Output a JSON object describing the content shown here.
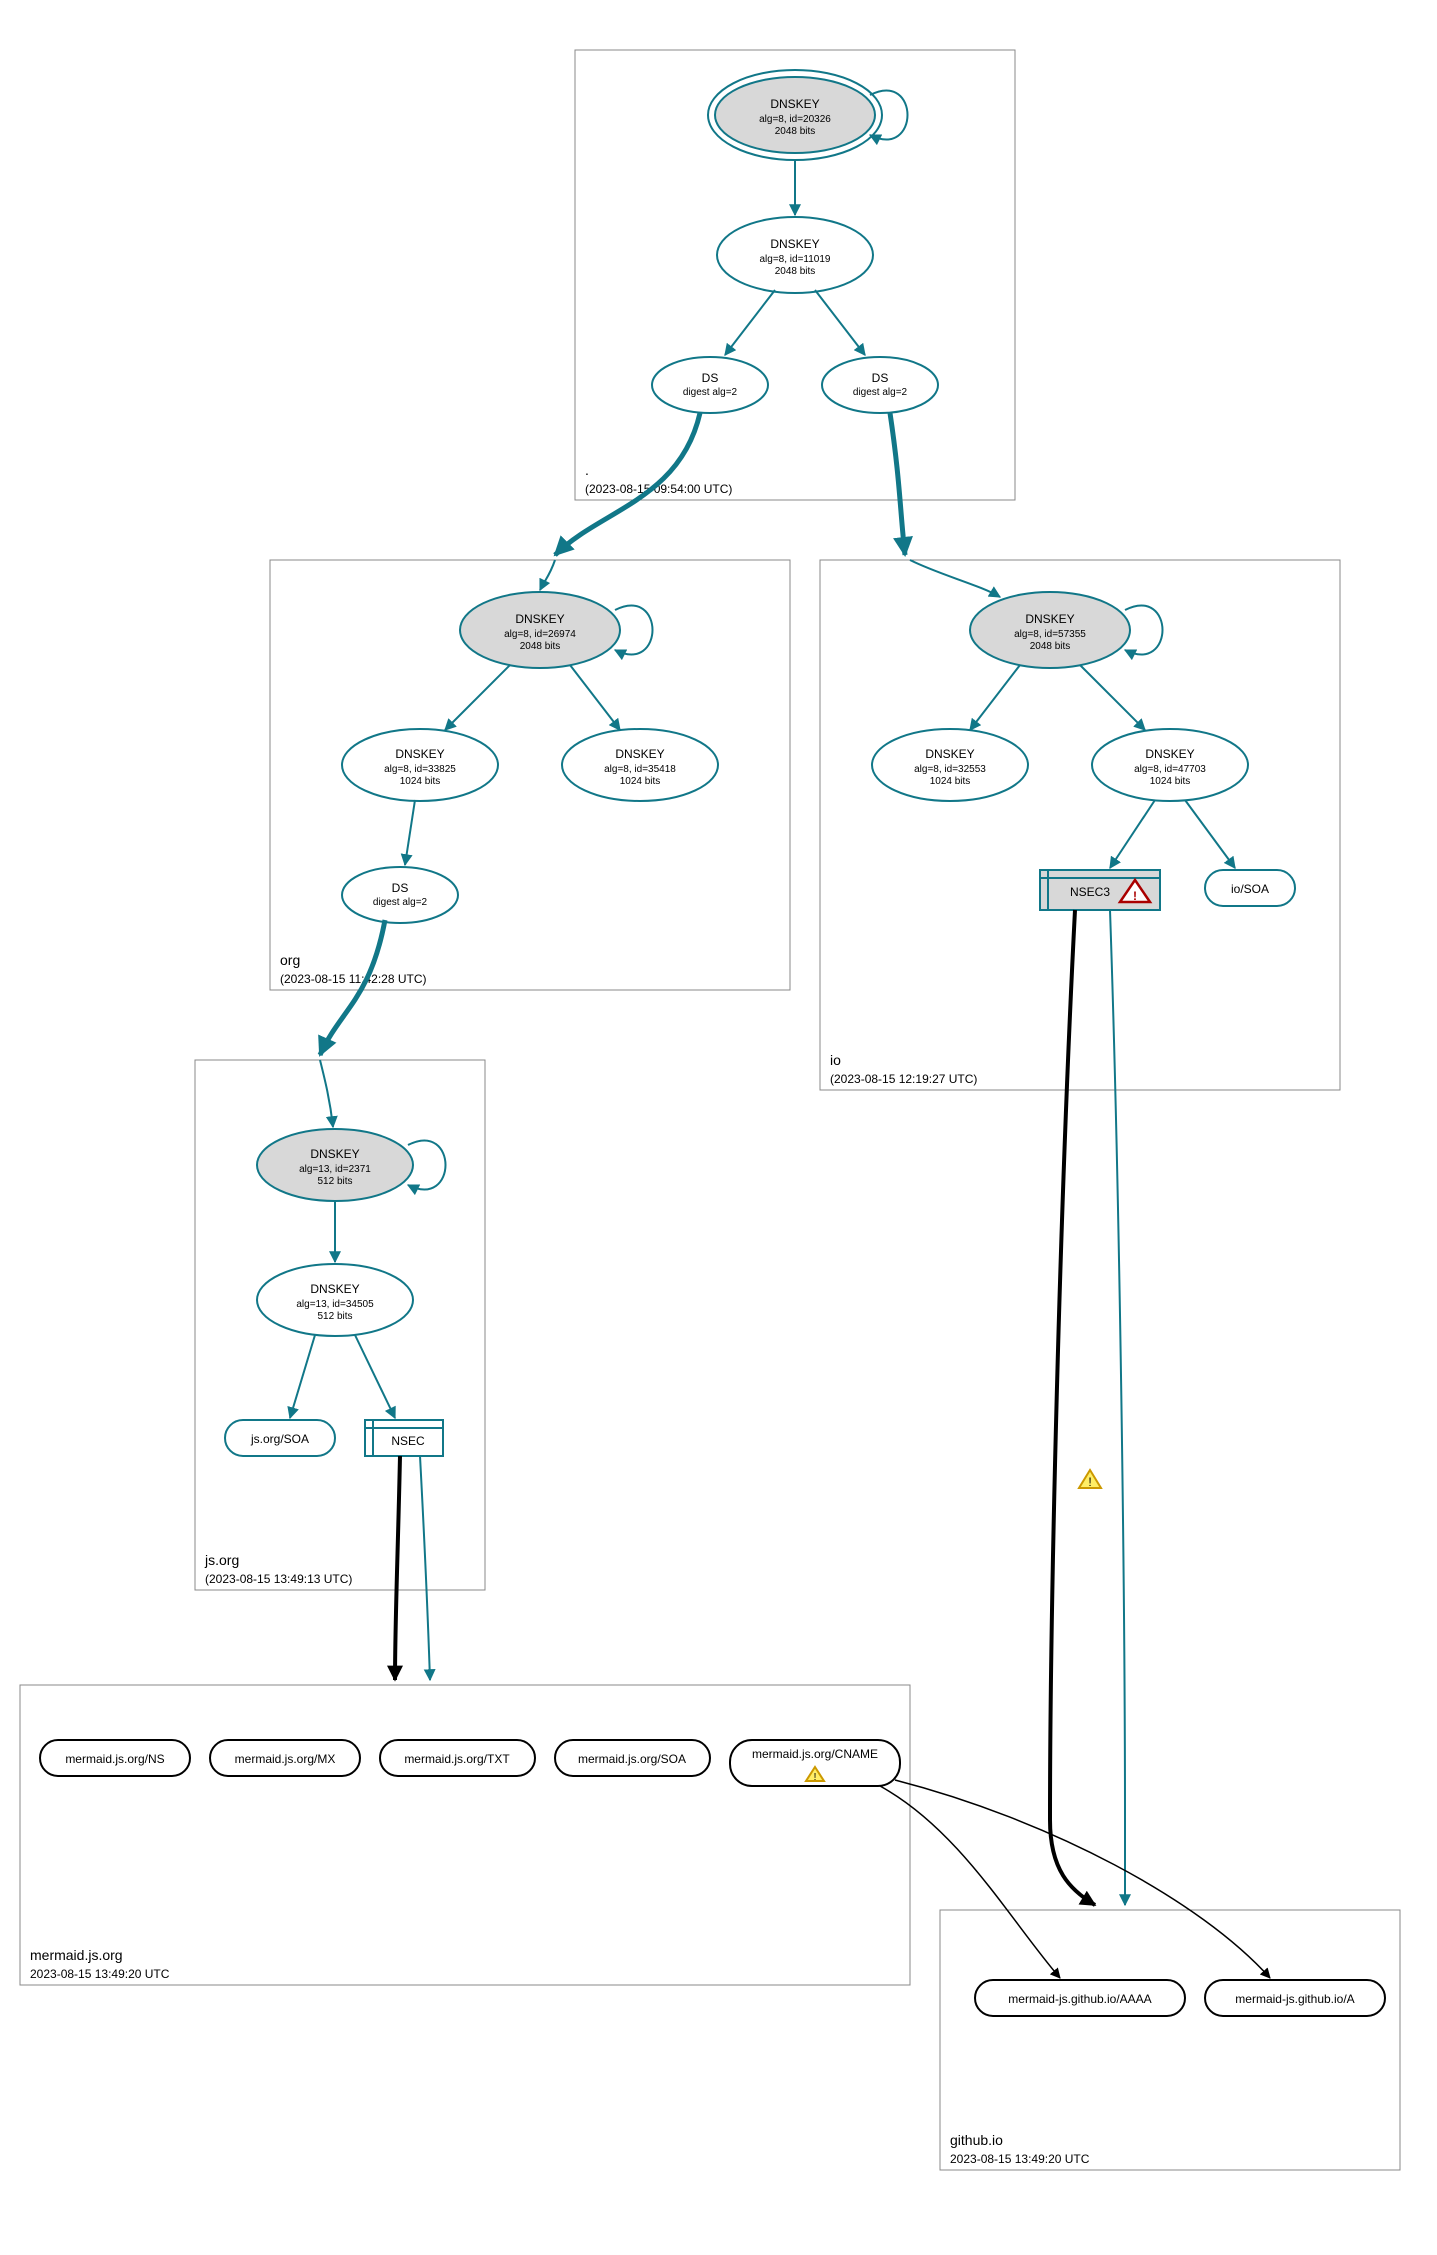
{
  "clusters": {
    "root": {
      "label": ".",
      "timestamp": "(2023-08-15 09:54:00 UTC)"
    },
    "org": {
      "label": "org",
      "timestamp": "(2023-08-15 11:42:28 UTC)"
    },
    "io": {
      "label": "io",
      "timestamp": "(2023-08-15 12:19:27 UTC)"
    },
    "jsorg": {
      "label": "js.org",
      "timestamp": "(2023-08-15 13:49:13 UTC)"
    },
    "mermaidjsorg": {
      "label": "mermaid.js.org",
      "timestamp": "2023-08-15 13:49:20 UTC"
    },
    "githubio": {
      "label": "github.io",
      "timestamp": "2023-08-15 13:49:20 UTC"
    }
  },
  "nodes": {
    "root_ksk": {
      "title": "DNSKEY",
      "line2": "alg=8, id=20326",
      "line3": "2048 bits"
    },
    "root_zsk": {
      "title": "DNSKEY",
      "line2": "alg=8, id=11019",
      "line3": "2048 bits"
    },
    "root_ds1": {
      "title": "DS",
      "line2": "digest alg=2"
    },
    "root_ds2": {
      "title": "DS",
      "line2": "digest alg=2"
    },
    "org_ksk": {
      "title": "DNSKEY",
      "line2": "alg=8, id=26974",
      "line3": "2048 bits"
    },
    "org_zsk1": {
      "title": "DNSKEY",
      "line2": "alg=8, id=33825",
      "line3": "1024 bits"
    },
    "org_zsk2": {
      "title": "DNSKEY",
      "line2": "alg=8, id=35418",
      "line3": "1024 bits"
    },
    "org_ds": {
      "title": "DS",
      "line2": "digest alg=2"
    },
    "io_ksk": {
      "title": "DNSKEY",
      "line2": "alg=8, id=57355",
      "line3": "2048 bits"
    },
    "io_zsk1": {
      "title": "DNSKEY",
      "line2": "alg=8, id=32553",
      "line3": "1024 bits"
    },
    "io_zsk2": {
      "title": "DNSKEY",
      "line2": "alg=8, id=47703",
      "line3": "1024 bits"
    },
    "io_nsec3": {
      "title": "NSEC3"
    },
    "io_soa": {
      "title": "io/SOA"
    },
    "jsorg_ksk": {
      "title": "DNSKEY",
      "line2": "alg=13, id=2371",
      "line3": "512 bits"
    },
    "jsorg_zsk": {
      "title": "DNSKEY",
      "line2": "alg=13, id=34505",
      "line3": "512 bits"
    },
    "jsorg_soa": {
      "title": "js.org/SOA"
    },
    "jsorg_nsec": {
      "title": "NSEC"
    },
    "m_ns": {
      "title": "mermaid.js.org/NS"
    },
    "m_mx": {
      "title": "mermaid.js.org/MX"
    },
    "m_txt": {
      "title": "mermaid.js.org/TXT"
    },
    "m_soa": {
      "title": "mermaid.js.org/SOA"
    },
    "m_cname": {
      "title": "mermaid.js.org/CNAME"
    },
    "gh_aaaa": {
      "title": "mermaid-js.github.io/AAAA"
    },
    "gh_a": {
      "title": "mermaid-js.github.io/A"
    }
  }
}
